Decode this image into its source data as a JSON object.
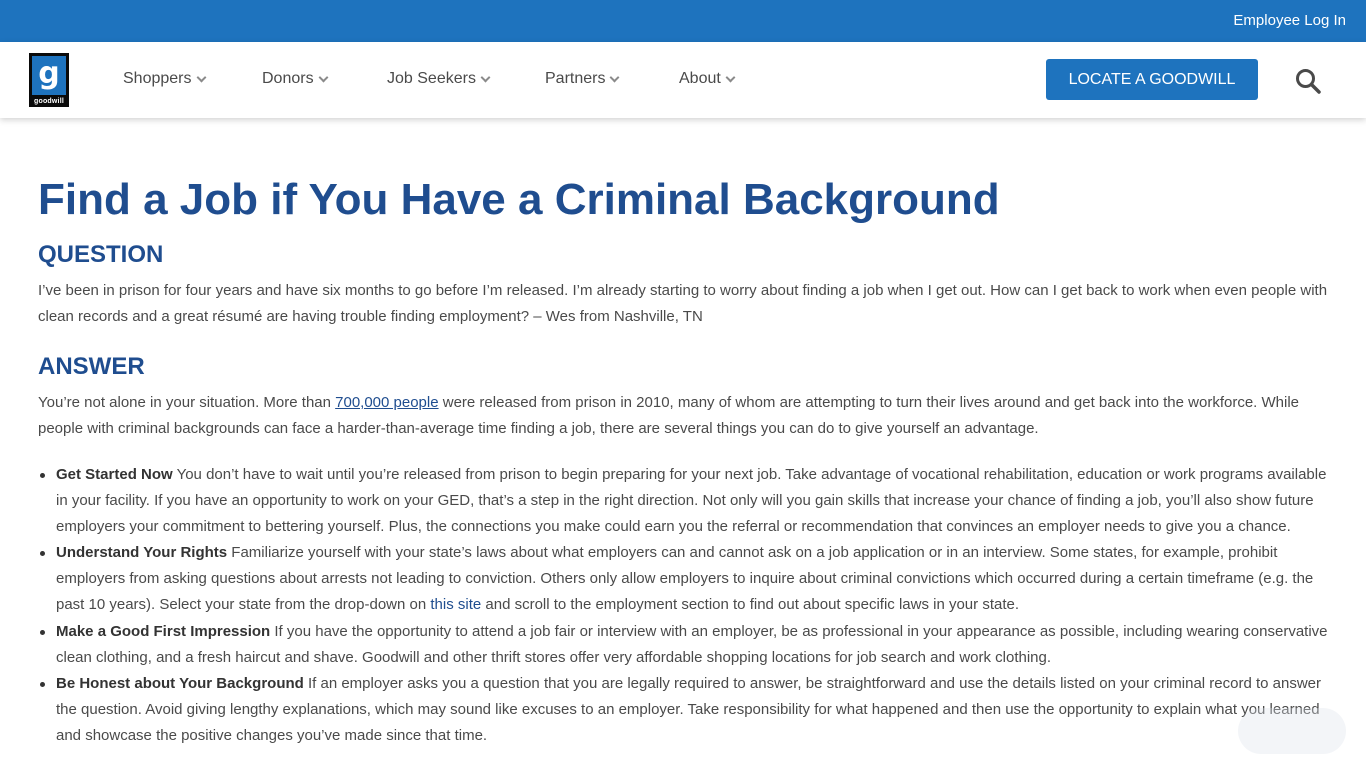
{
  "top_bar": {
    "employee_login": "Employee Log In"
  },
  "logo": {
    "glyph": "g",
    "wordmark": "goodwill"
  },
  "nav": {
    "items": [
      {
        "label": "Shoppers"
      },
      {
        "label": "Donors"
      },
      {
        "label": "Job Seekers"
      },
      {
        "label": "Partners"
      },
      {
        "label": "About"
      }
    ],
    "locate_button": "LOCATE A GOODWILL"
  },
  "article": {
    "title": "Find a Job if You Have a Criminal Background",
    "question_heading": "QUESTION",
    "question_text": "I’ve been in prison for four years and have six months to go before I’m released. I’m already starting to worry about finding a job when I get out. How can I get back to work when even people with clean records and a great résumé are having trouble finding employment? – Wes from Nashville, TN",
    "answer_heading": "ANSWER",
    "answer_pre": "You’re not alone in your situation. More than ",
    "answer_link": "700,000 people",
    "answer_post": " were released from prison in 2010, many of whom are attempting to turn their lives around and get back into the workforce. While people with criminal backgrounds can face a harder-than-average time finding a job, there are several things you can do to give yourself an advantage.",
    "tips": [
      {
        "title": "Get Started Now",
        "text": " You don’t have to wait until you’re released from prison to begin preparing for your next job. Take advantage of vocational rehabilitation, education or work programs available in your facility. If you have an opportunity to work on your GED, that’s a step in the right direction. Not only will you gain skills that increase your chance of finding a job, you’ll also show future employers your commitment to bettering yourself. Plus, the connections you make could earn you the referral or recommendation that convinces an employer needs to give you a chance."
      },
      {
        "title": "Understand Your Rights",
        "text": " Familiarize yourself with your state’s laws about what employers can and cannot ask on a job application or in an interview. Some states, for example, prohibit employers from asking questions about arrests not leading to conviction. Others only allow employers to inquire about criminal convictions which occurred during a certain timeframe (e.g. the past 10 years). Select your state from the drop-down on ",
        "link": "this site",
        "text_after": " and scroll to the employment section to find out about specific laws in your state."
      },
      {
        "title": "Make a Good First Impression",
        "text": " If you have the opportunity to attend a job fair or interview with an employer, be as professional in your appearance as possible, including wearing conservative clean clothing, and a fresh haircut and shave. Goodwill and other thrift stores offer very affordable shopping locations for job search and work clothing."
      },
      {
        "title": "Be Honest about Your Background",
        "text": " If an employer asks you a question that you are legally required to answer, be straightforward and use the details listed on your criminal record to answer the question. Avoid giving lengthy explanations, which may sound like excuses to an employer. Take responsibility for what happened and then use the opportunity to explain what you learned and showcase the positive changes you’ve made since that time."
      }
    ]
  },
  "colors": {
    "brand_blue": "#1e73be",
    "heading_blue": "#1f4d8f",
    "body_text": "#4a4a4a"
  },
  "icons": {
    "search": "search-icon",
    "chevron": "chevron-down-icon"
  }
}
